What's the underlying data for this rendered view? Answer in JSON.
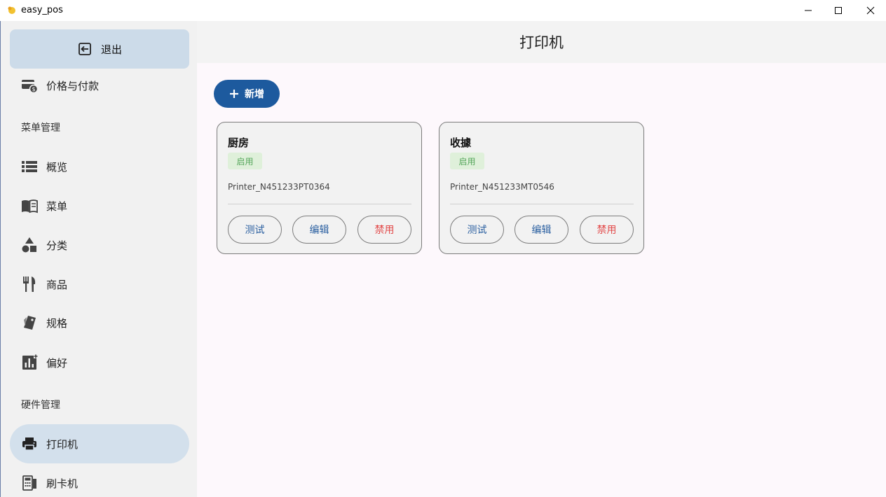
{
  "window": {
    "title": "easy_pos"
  },
  "sidebar": {
    "exit_label": "退出",
    "items": [
      {
        "label": "价格与付款",
        "icon": "price-payment-icon"
      },
      {
        "label": "概览",
        "icon": "list-icon"
      },
      {
        "label": "菜单",
        "icon": "menu-book-icon"
      },
      {
        "label": "分类",
        "icon": "category-shapes-icon"
      },
      {
        "label": "商品",
        "icon": "fork-knife-icon"
      },
      {
        "label": "规格",
        "icon": "tag-icon"
      },
      {
        "label": "偏好",
        "icon": "insights-icon"
      },
      {
        "label": "打印机",
        "icon": "printer-icon",
        "active": true
      },
      {
        "label": "刷卡机",
        "icon": "card-terminal-icon"
      }
    ],
    "sections": {
      "menu_management": "菜单管理",
      "hardware_management": "硬件管理"
    }
  },
  "header": {
    "title": "打印机"
  },
  "toolbar": {
    "add_label": "新增"
  },
  "printers": [
    {
      "name": "厨房",
      "status": "启用",
      "device": "Printer_N451233PT0364",
      "test_label": "测试",
      "edit_label": "编辑",
      "disable_label": "禁用"
    },
    {
      "name": "收據",
      "status": "启用",
      "device": "Printer_N451233MT0546",
      "test_label": "测试",
      "edit_label": "编辑",
      "disable_label": "禁用"
    }
  ],
  "colors": {
    "accent": "#1d5a9e",
    "active_nav": "#d3e0ec",
    "status_green": "#57a75c",
    "danger": "#e24a4a"
  }
}
